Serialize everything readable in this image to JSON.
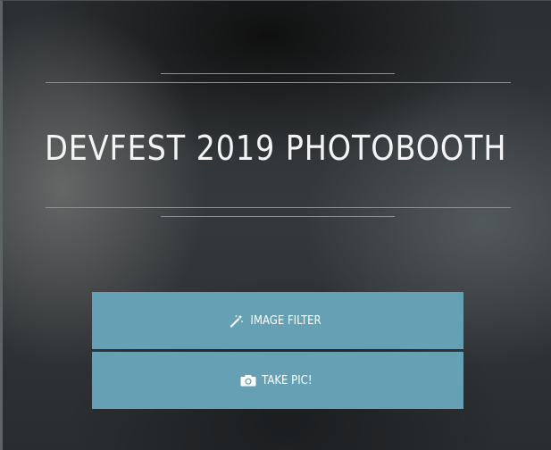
{
  "header": {
    "title": "DEVFEST 2019 PHOTOBOOTH"
  },
  "actions": {
    "image_filter": {
      "label": "IMAGE FILTER",
      "icon": "magic-wand-icon"
    },
    "take_pic": {
      "label": "TAKE PIC!",
      "icon": "camera-icon"
    }
  },
  "colors": {
    "button_bg": "#65a0b5",
    "title_text": "#f4f4f4",
    "divider": "#8c9092"
  }
}
